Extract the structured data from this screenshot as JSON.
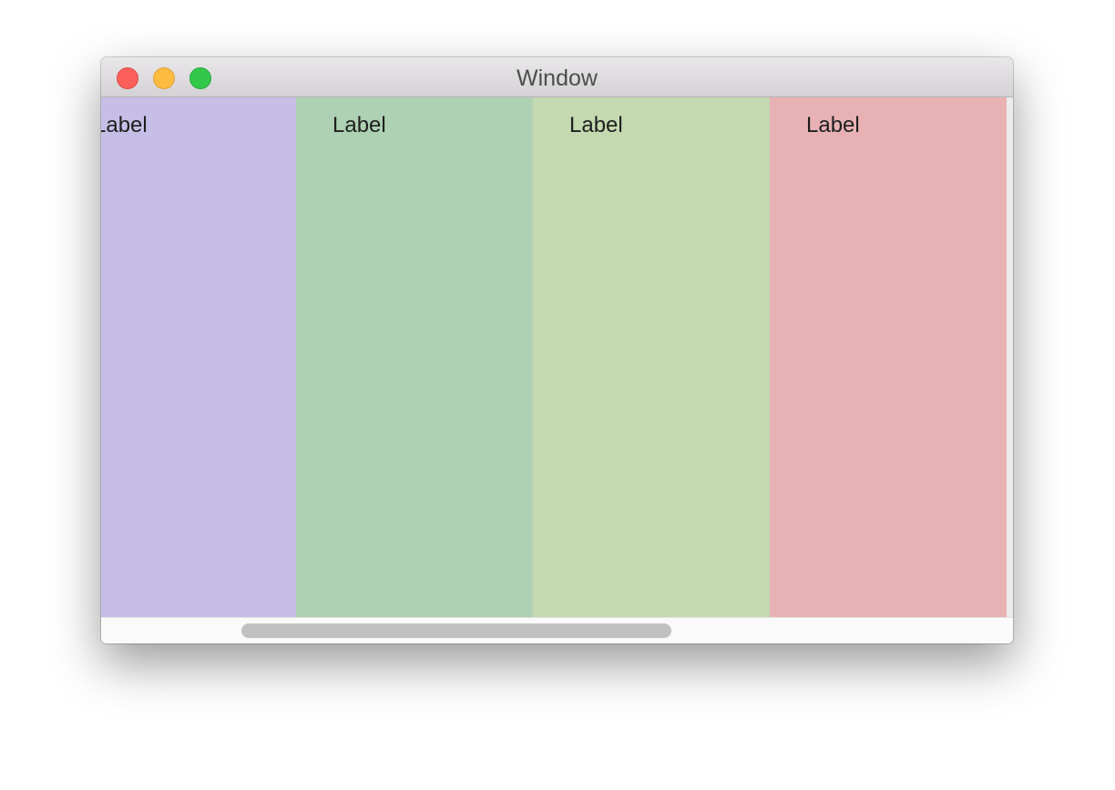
{
  "window": {
    "title": "Window"
  },
  "columns": [
    {
      "label": "Label",
      "color": "#c7bee7"
    },
    {
      "label": "Label",
      "color": "#add1b2"
    },
    {
      "label": "Label",
      "color": "#c4d9b0"
    },
    {
      "label": "Label",
      "color": "#e8b2b4"
    }
  ],
  "scrollbar": {
    "horizontal_position_fraction": 0.17,
    "visible_fraction": 0.52
  }
}
